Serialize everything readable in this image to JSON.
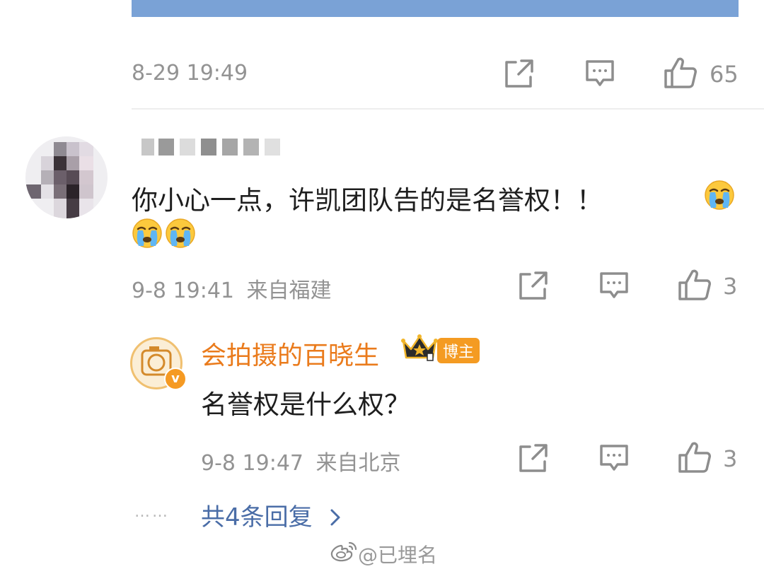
{
  "prev_post": {
    "timestamp": "8-29 19:49",
    "like_count": "65"
  },
  "comment": {
    "text_line1": "你小心一点，许凯团队告的是名誉权！！",
    "timestamp": "9-8 19:41",
    "location": "来自福建",
    "like_count": "3"
  },
  "reply": {
    "author": "会拍摄的百晓生",
    "badge": "博主",
    "verified_mark": "v",
    "text": "名誉权是什么权？",
    "timestamp": "9-8 19:47",
    "location": "来自北京",
    "like_count": "3"
  },
  "more_replies": {
    "label": "共4条回复",
    "dots": "……"
  },
  "watermark": {
    "text": "@已埋名"
  },
  "colors": {
    "accent_blue": "#7aa2d6",
    "author_orange": "#ea7b1c",
    "link_blue": "#4a6da7",
    "meta_gray": "#939393"
  },
  "icons": [
    "share-icon",
    "comment-icon",
    "like-icon",
    "cry-emoji",
    "crown-icon",
    "weibo-logo"
  ]
}
